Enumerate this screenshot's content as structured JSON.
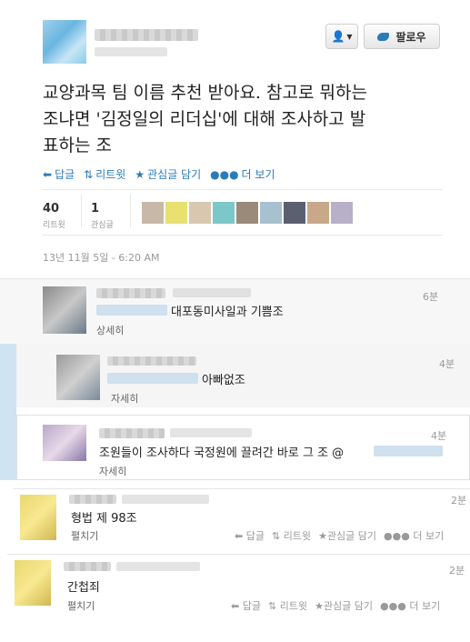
{
  "header": {
    "follow_label": "팔로우",
    "user_btn_icon": "user-icon",
    "follow_icon": "twitter-bird-icon"
  },
  "tweet": {
    "text": "교양과목 팀 이름 추천 받아요. 참고로 뭐하는\n조냐면 '김정일의 리더십'에 대해 조사하고 발\n표하는 조",
    "actions": {
      "reply": "답글",
      "retweet": "리트윗",
      "favorite": "관심글 담기",
      "more": "더 보기"
    },
    "stats": {
      "retweets": "40",
      "retweets_label": "리트윗",
      "favorites": "1",
      "favorites_label": "관심글"
    },
    "timestamp": "13년 11월 5일 - 6:20 AM"
  },
  "replies": [
    {
      "time": "6분",
      "text": "대포동미사일과 기쁨조",
      "link": "상세히"
    },
    {
      "time": "4분",
      "text": "아빠없조",
      "link": "자세히"
    },
    {
      "time": "4분",
      "text": "조원들이 조사하다 국정원에 끌려간 바로 그 조 @",
      "link": "자세히"
    },
    {
      "time": "2분",
      "text": "형법 제 98조",
      "link": "펼치기",
      "actions": {
        "reply": "답글",
        "retweet": "리트윗",
        "favorite": "관심글 담기",
        "more": "더 보기"
      }
    },
    {
      "time": "2분",
      "text": "간첩죄",
      "link": "펼치기",
      "actions": {
        "reply": "답글",
        "retweet": "리트윗",
        "favorite": "관심글 담기",
        "more": "더 보기"
      }
    }
  ],
  "colors": {
    "link": "#2b7bb9",
    "muted": "#999999",
    "reply_bg": "#f5f5f5",
    "accent_strip": "#cfe4f2"
  }
}
